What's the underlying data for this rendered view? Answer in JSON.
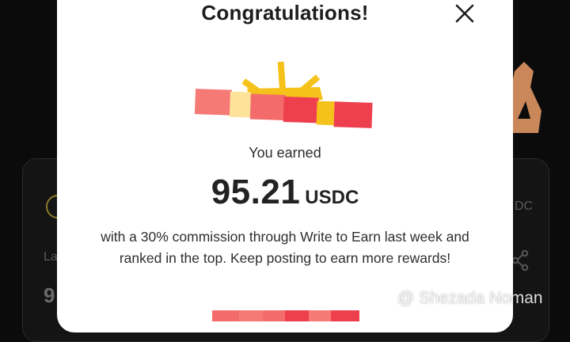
{
  "background": {
    "card_label_partial": "La",
    "card_value_partial": "9",
    "card_currency_partial": "DC"
  },
  "modal": {
    "title": "Congratulations!",
    "earned_label": "You earned",
    "amount": "95.21",
    "currency": "USDC",
    "description": "with a 30% commission through Write to Earn last week and ranked in the top. Keep posting to earn more rewards!"
  },
  "watermark": {
    "text": "@ Shezada Noman"
  },
  "colors": {
    "gift_coral": "#f36b6b",
    "gift_red": "#ee3f4f",
    "gift_yellow": "#f5c21b",
    "gift_cream": "#fde39a"
  }
}
